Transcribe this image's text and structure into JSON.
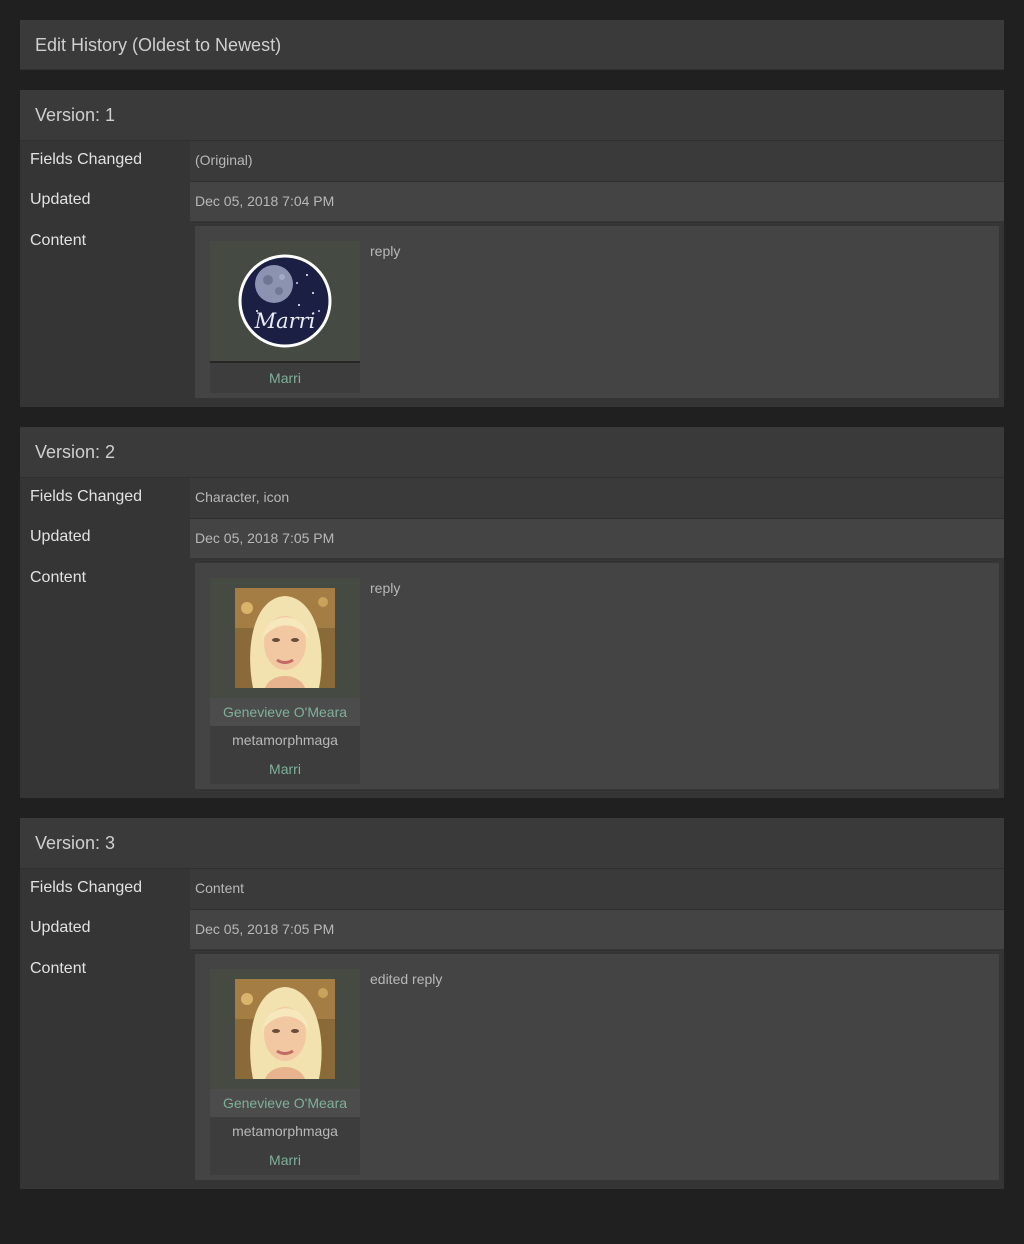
{
  "history": {
    "title": "Edit History (Oldest to Newest)"
  },
  "labels": {
    "fields": "Fields Changed",
    "updated": "Updated",
    "content": "Content"
  },
  "versions": [
    {
      "title": "Version: 1",
      "fields": "(Original)",
      "updated": "Dec 05, 2018 7:04 PM",
      "icon": "moon-marri-icon",
      "author": "Marri",
      "text": "reply"
    },
    {
      "title": "Version: 2",
      "fields": "Character, icon",
      "updated": "Dec 05, 2018 7:05 PM",
      "icon": "portrait-icon",
      "character": "Genevieve O'Meara",
      "screenname": "metamorphmaga",
      "author": "Marri",
      "text": "reply"
    },
    {
      "title": "Version: 3",
      "fields": "Content",
      "updated": "Dec 05, 2018 7:05 PM",
      "icon": "portrait-icon",
      "character": "Genevieve O'Meara",
      "screenname": "metamorphmaga",
      "author": "Marri",
      "text": "edited reply"
    }
  ],
  "icon_text": {
    "moon": "Marri"
  },
  "colors": {
    "background": "#202020",
    "panel": "#3a3a3a",
    "link": "#7fb09a"
  }
}
